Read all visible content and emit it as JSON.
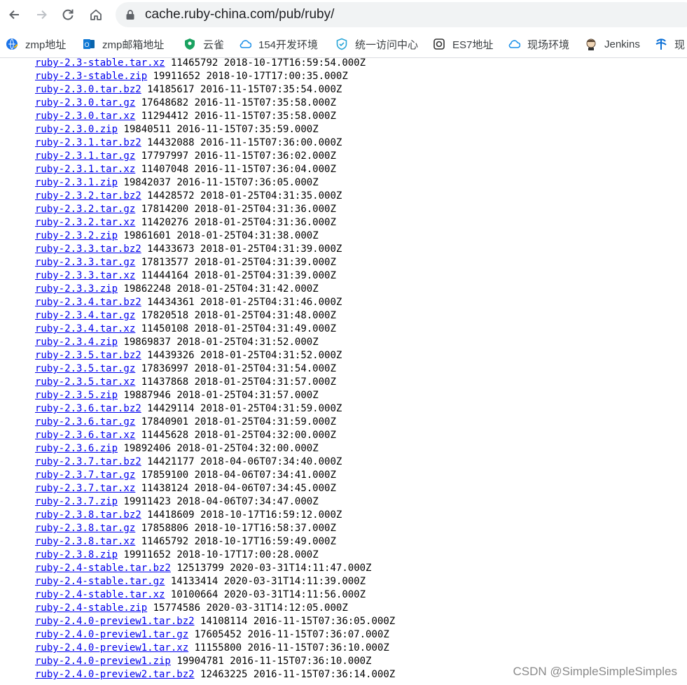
{
  "browser": {
    "url": "cache.ruby-china.com/pub/ruby/"
  },
  "bookmarks": [
    {
      "label": "zmp地址",
      "icon": "globe-edit-icon"
    },
    {
      "label": "zmp邮箱地址",
      "icon": "outlook-icon"
    },
    {
      "label": "云雀",
      "icon": "shield-green-icon"
    },
    {
      "label": "154开发环境",
      "icon": "cloud-icon"
    },
    {
      "label": "统一访问中心",
      "icon": "shield-check-icon"
    },
    {
      "label": "ES7地址",
      "icon": "elastic-icon"
    },
    {
      "label": "现场环境",
      "icon": "cloud-icon"
    },
    {
      "label": "Jenkins",
      "icon": "jenkins-icon"
    },
    {
      "label": "现",
      "icon": "telecom-icon"
    }
  ],
  "files": [
    {
      "name": "ruby-2.3-stable.tar.xz",
      "size": "11465792",
      "date": "2018-10-17T16:59:54.000Z"
    },
    {
      "name": "ruby-2.3-stable.zip",
      "size": "19911652",
      "date": "2018-10-17T17:00:35.000Z"
    },
    {
      "name": "ruby-2.3.0.tar.bz2",
      "size": "14185617",
      "date": "2016-11-15T07:35:54.000Z"
    },
    {
      "name": "ruby-2.3.0.tar.gz",
      "size": "17648682",
      "date": "2016-11-15T07:35:58.000Z"
    },
    {
      "name": "ruby-2.3.0.tar.xz",
      "size": "11294412",
      "date": "2016-11-15T07:35:58.000Z"
    },
    {
      "name": "ruby-2.3.0.zip",
      "size": "19840511",
      "date": "2016-11-15T07:35:59.000Z"
    },
    {
      "name": "ruby-2.3.1.tar.bz2",
      "size": "14432088",
      "date": "2016-11-15T07:36:00.000Z"
    },
    {
      "name": "ruby-2.3.1.tar.gz",
      "size": "17797997",
      "date": "2016-11-15T07:36:02.000Z"
    },
    {
      "name": "ruby-2.3.1.tar.xz",
      "size": "11407048",
      "date": "2016-11-15T07:36:04.000Z"
    },
    {
      "name": "ruby-2.3.1.zip",
      "size": "19842037",
      "date": "2016-11-15T07:36:05.000Z"
    },
    {
      "name": "ruby-2.3.2.tar.bz2",
      "size": "14428572",
      "date": "2018-01-25T04:31:35.000Z"
    },
    {
      "name": "ruby-2.3.2.tar.gz",
      "size": "17814200",
      "date": "2018-01-25T04:31:36.000Z"
    },
    {
      "name": "ruby-2.3.2.tar.xz",
      "size": "11420276",
      "date": "2018-01-25T04:31:36.000Z"
    },
    {
      "name": "ruby-2.3.2.zip",
      "size": "19861601",
      "date": "2018-01-25T04:31:38.000Z"
    },
    {
      "name": "ruby-2.3.3.tar.bz2",
      "size": "14433673",
      "date": "2018-01-25T04:31:39.000Z"
    },
    {
      "name": "ruby-2.3.3.tar.gz",
      "size": "17813577",
      "date": "2018-01-25T04:31:39.000Z"
    },
    {
      "name": "ruby-2.3.3.tar.xz",
      "size": "11444164",
      "date": "2018-01-25T04:31:39.000Z"
    },
    {
      "name": "ruby-2.3.3.zip",
      "size": "19862248",
      "date": "2018-01-25T04:31:42.000Z"
    },
    {
      "name": "ruby-2.3.4.tar.bz2",
      "size": "14434361",
      "date": "2018-01-25T04:31:46.000Z"
    },
    {
      "name": "ruby-2.3.4.tar.gz",
      "size": "17820518",
      "date": "2018-01-25T04:31:48.000Z"
    },
    {
      "name": "ruby-2.3.4.tar.xz",
      "size": "11450108",
      "date": "2018-01-25T04:31:49.000Z"
    },
    {
      "name": "ruby-2.3.4.zip",
      "size": "19869837",
      "date": "2018-01-25T04:31:52.000Z"
    },
    {
      "name": "ruby-2.3.5.tar.bz2",
      "size": "14439326",
      "date": "2018-01-25T04:31:52.000Z"
    },
    {
      "name": "ruby-2.3.5.tar.gz",
      "size": "17836997",
      "date": "2018-01-25T04:31:54.000Z"
    },
    {
      "name": "ruby-2.3.5.tar.xz",
      "size": "11437868",
      "date": "2018-01-25T04:31:57.000Z"
    },
    {
      "name": "ruby-2.3.5.zip",
      "size": "19887946",
      "date": "2018-01-25T04:31:57.000Z"
    },
    {
      "name": "ruby-2.3.6.tar.bz2",
      "size": "14429114",
      "date": "2018-01-25T04:31:59.000Z"
    },
    {
      "name": "ruby-2.3.6.tar.gz",
      "size": "17840901",
      "date": "2018-01-25T04:31:59.000Z"
    },
    {
      "name": "ruby-2.3.6.tar.xz",
      "size": "11445628",
      "date": "2018-01-25T04:32:00.000Z"
    },
    {
      "name": "ruby-2.3.6.zip",
      "size": "19892406",
      "date": "2018-01-25T04:32:00.000Z"
    },
    {
      "name": "ruby-2.3.7.tar.bz2",
      "size": "14421177",
      "date": "2018-04-06T07:34:40.000Z"
    },
    {
      "name": "ruby-2.3.7.tar.gz",
      "size": "17859100",
      "date": "2018-04-06T07:34:41.000Z"
    },
    {
      "name": "ruby-2.3.7.tar.xz",
      "size": "11438124",
      "date": "2018-04-06T07:34:45.000Z"
    },
    {
      "name": "ruby-2.3.7.zip",
      "size": "19911423",
      "date": "2018-04-06T07:34:47.000Z"
    },
    {
      "name": "ruby-2.3.8.tar.bz2",
      "size": "14418609",
      "date": "2018-10-17T16:59:12.000Z"
    },
    {
      "name": "ruby-2.3.8.tar.gz",
      "size": "17858806",
      "date": "2018-10-17T16:58:37.000Z"
    },
    {
      "name": "ruby-2.3.8.tar.xz",
      "size": "11465792",
      "date": "2018-10-17T16:59:49.000Z"
    },
    {
      "name": "ruby-2.3.8.zip",
      "size": "19911652",
      "date": "2018-10-17T17:00:28.000Z"
    },
    {
      "name": "ruby-2.4-stable.tar.bz2",
      "size": "12513799",
      "date": "2020-03-31T14:11:47.000Z"
    },
    {
      "name": "ruby-2.4-stable.tar.gz",
      "size": "14133414",
      "date": "2020-03-31T14:11:39.000Z"
    },
    {
      "name": "ruby-2.4-stable.tar.xz",
      "size": "10100664",
      "date": "2020-03-31T14:11:56.000Z"
    },
    {
      "name": "ruby-2.4-stable.zip",
      "size": "15774586",
      "date": "2020-03-31T14:12:05.000Z"
    },
    {
      "name": "ruby-2.4.0-preview1.tar.bz2",
      "size": "14108114",
      "date": "2016-11-15T07:36:05.000Z"
    },
    {
      "name": "ruby-2.4.0-preview1.tar.gz",
      "size": "17605452",
      "date": "2016-11-15T07:36:07.000Z"
    },
    {
      "name": "ruby-2.4.0-preview1.tar.xz",
      "size": "11155800",
      "date": "2016-11-15T07:36:10.000Z"
    },
    {
      "name": "ruby-2.4.0-preview1.zip",
      "size": "19904781",
      "date": "2016-11-15T07:36:10.000Z"
    },
    {
      "name": "ruby-2.4.0-preview2.tar.bz2",
      "size": "12463225",
      "date": "2016-11-15T07:36:14.000Z"
    }
  ],
  "watermark": "CSDN @SimpleSimpleSimples"
}
